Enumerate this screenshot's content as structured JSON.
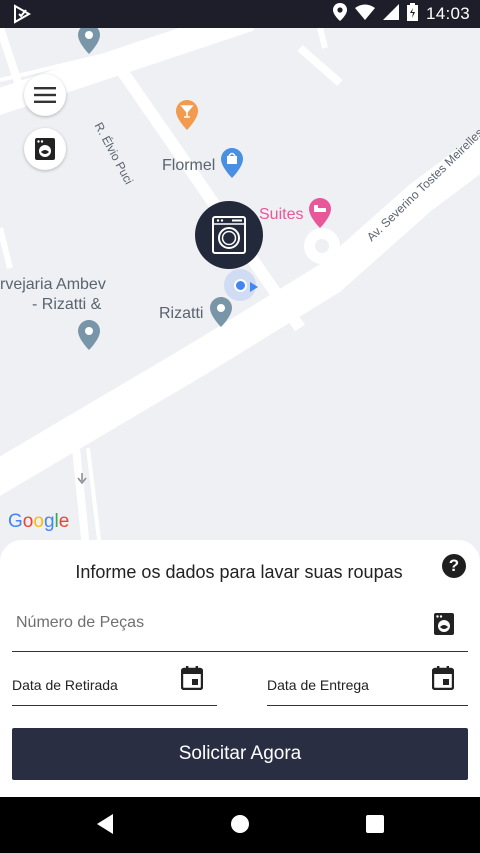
{
  "status_bar": {
    "time": "14:03",
    "icons": [
      "play-protect-icon",
      "location-icon",
      "wifi-icon",
      "signal-icon",
      "battery-icon"
    ]
  },
  "map": {
    "pois": [
      {
        "name": "Flormel",
        "icon": "shopping-bag-pin",
        "color": "#4a90e2"
      },
      {
        "name": "Suites",
        "icon": "hotel-pin",
        "color": "#e8579a"
      },
      {
        "name": "Rizatti",
        "icon": "pin",
        "color": "#7996a8"
      },
      {
        "name_line1": "rvejaria Ambev",
        "name_line2": "- Rizatti &",
        "icon": "pin",
        "color": "#7996a8"
      }
    ],
    "streets": [
      "R. Élvio Puci",
      "Av. Severino Tostes Meirelles"
    ],
    "google_logo": "Google"
  },
  "form": {
    "title": "Informe os dados para lavar suas roupas",
    "pieces_placeholder": "Número de Peças",
    "pickup_label": "Data de Retirada",
    "delivery_label": "Data de Entrega",
    "submit_label": "Solicitar Agora"
  },
  "colors": {
    "primary": "#2a2e43",
    "map_bg": "#eef0f3",
    "location_blue": "#4285f4"
  }
}
